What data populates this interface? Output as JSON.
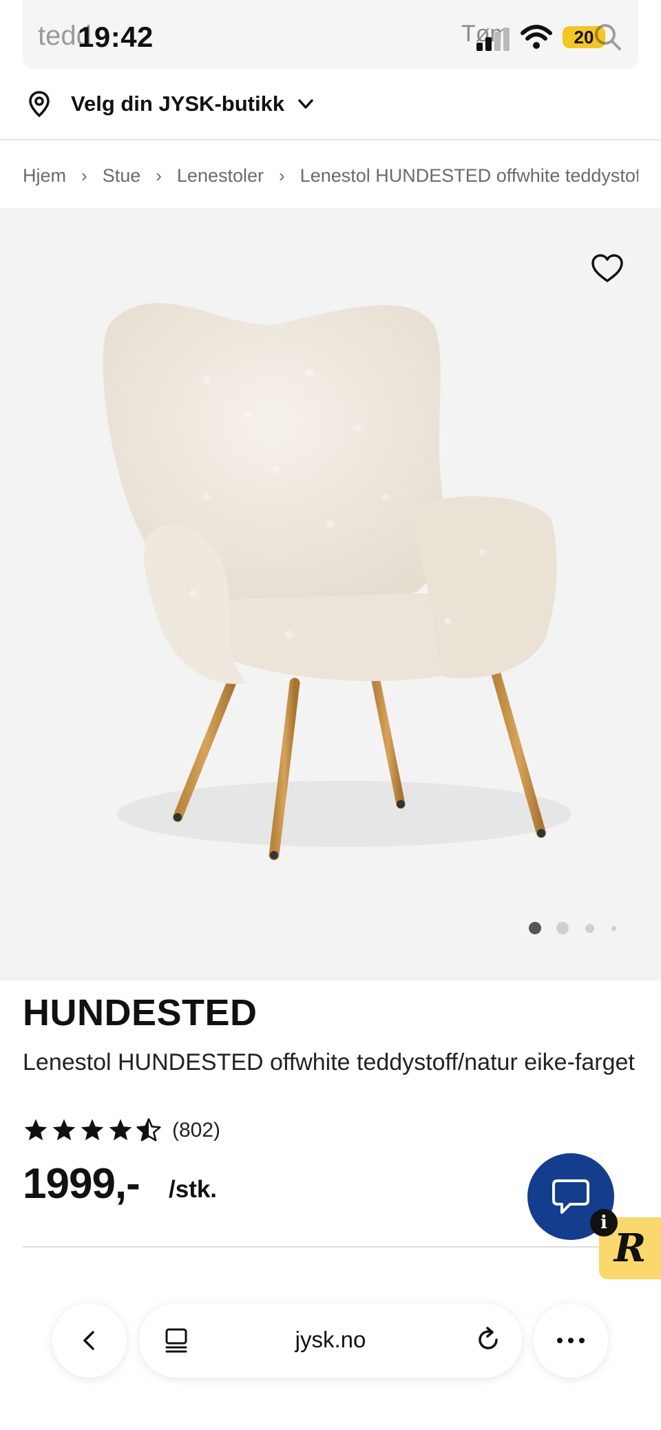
{
  "status": {
    "search_ghost": "tedd",
    "time": "19:42",
    "clear_ghost": "Tøm",
    "battery": "20"
  },
  "store": {
    "label": "Velg din JYSK-butikk"
  },
  "breadcrumb": [
    "Hjem",
    "Stue",
    "Lenestoler",
    "Lenestol HUNDESTED offwhite teddystoff/natur eike-farget"
  ],
  "gallery": {
    "image_count": 4,
    "active_index": 0
  },
  "product": {
    "brand": "HUNDESTED",
    "description": "Lenestol HUNDESTED offwhite teddystoff/natur eike-farget",
    "rating": 4.5,
    "reviews": "(802)",
    "price": "1999,-",
    "unit": "/stk."
  },
  "browser": {
    "url": "jysk.no"
  },
  "colors": {
    "chat_blue": "#143d8d",
    "badge_yellow": "#fbd86d",
    "battery_yellow": "#f3c623"
  },
  "icons": [
    "location-pin-icon",
    "chevron-down-icon",
    "heart-icon",
    "star-icon",
    "chat-icon",
    "info-icon",
    "back-icon",
    "tabs-icon",
    "reload-icon",
    "more-icon"
  ]
}
